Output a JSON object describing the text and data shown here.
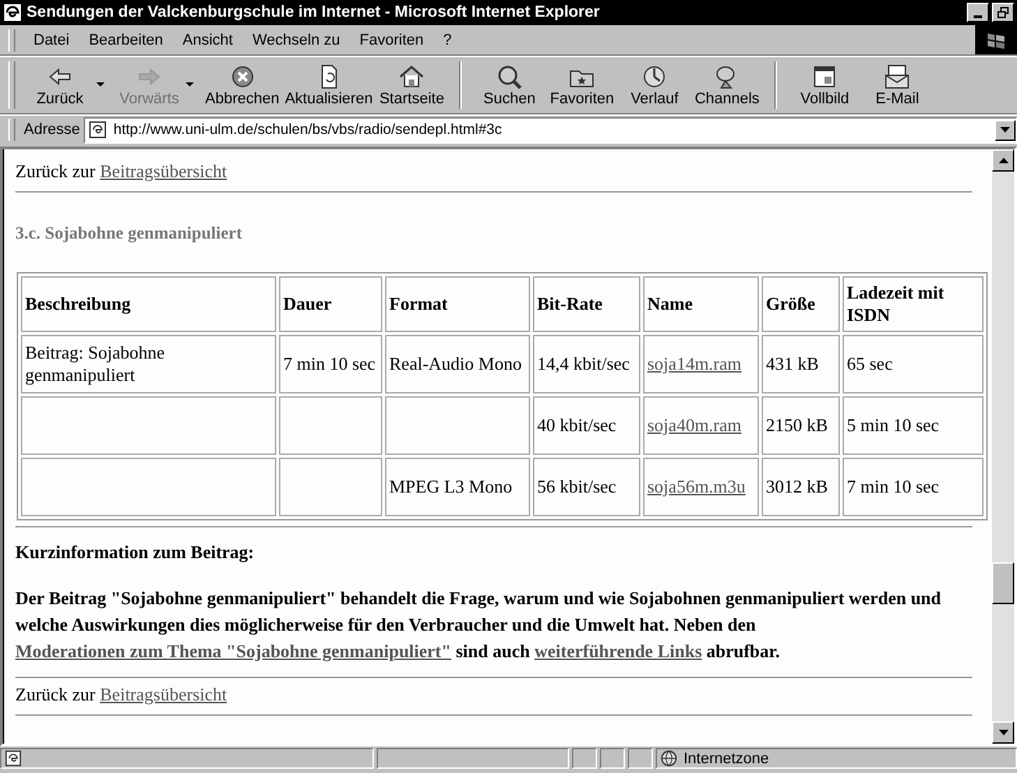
{
  "window": {
    "title": "Sendungen der Valckenburgschule im Internet - Microsoft Internet Explorer"
  },
  "menu": [
    "Datei",
    "Bearbeiten",
    "Ansicht",
    "Wechseln zu",
    "Favoriten",
    "?"
  ],
  "toolbar": [
    {
      "label": "Zurück",
      "disabled": false,
      "has_menu": true
    },
    {
      "label": "Vorwärts",
      "disabled": true,
      "has_menu": true
    },
    {
      "label": "Abbrechen",
      "disabled": false,
      "has_menu": false
    },
    {
      "label": "Aktualisieren",
      "disabled": false,
      "has_menu": false
    },
    {
      "label": "Startseite",
      "disabled": false,
      "has_menu": false
    },
    {
      "label": "Suchen",
      "disabled": false,
      "has_menu": false
    },
    {
      "label": "Favoriten",
      "disabled": false,
      "has_menu": false
    },
    {
      "label": "Verlauf",
      "disabled": false,
      "has_menu": false
    },
    {
      "label": "Channels",
      "disabled": false,
      "has_menu": false
    },
    {
      "label": "Vollbild",
      "disabled": false,
      "has_menu": false
    },
    {
      "label": "E-Mail",
      "disabled": false,
      "has_menu": false
    }
  ],
  "address": {
    "label": "Adresse",
    "value": "http://www.uni-ulm.de/schulen/bs/vbs/radio/sendepl.html#3c"
  },
  "page": {
    "back_top": {
      "text": "Zurück zur",
      "link": "Beitragsübersicht"
    },
    "heading": "3.c. Sojabohne genmanipuliert",
    "table": {
      "columns": [
        "Beschreibung",
        "Dauer",
        "Format",
        "Bit-Rate",
        "Name",
        "Größe",
        "Ladezeit mit ISDN"
      ],
      "rows": [
        [
          {
            "text": "Beitrag: Sojabohne genmanipuliert",
            "link": false
          },
          {
            "text": "7 min 10 sec",
            "link": false
          },
          {
            "text": "Real-Audio Mono",
            "link": false
          },
          {
            "text": "14,4 kbit/sec",
            "link": false
          },
          {
            "text": "soja14m.ram",
            "link": true
          },
          {
            "text": "431 kB",
            "link": false
          },
          {
            "text": "65 sec",
            "link": false
          }
        ],
        [
          null,
          null,
          null,
          {
            "text": "40 kbit/sec",
            "link": false
          },
          {
            "text": "soja40m.ram",
            "link": true
          },
          {
            "text": "2150 kB",
            "link": false
          },
          {
            "text": "5 min 10 sec",
            "link": false
          }
        ],
        [
          null,
          null,
          {
            "text": "MPEG L3 Mono",
            "link": false
          },
          {
            "text": "56 kbit/sec",
            "link": false
          },
          {
            "text": "soja56m.m3u",
            "link": true
          },
          {
            "text": "3012 kB",
            "link": false
          },
          {
            "text": "7 min 10 sec",
            "link": false
          }
        ]
      ]
    },
    "info_heading": "Kurzinformation zum Beitrag:",
    "info": [
      {
        "kind": "text",
        "text": "Der Beitrag \"Sojabohne genmanipuliert\" behandelt die Frage, warum und wie Sojabohnen genmanipuliert werden und welche Auswirkungen dies möglicherweise für den Verbraucher und die Umwelt hat. Neben den"
      },
      {
        "kind": "link",
        "text": "Moderationen zum Thema \"Sojabohne genmanipuliert\""
      },
      {
        "kind": "text",
        "text": "sind auch"
      },
      {
        "kind": "link",
        "text": "weiterführende Links"
      },
      {
        "kind": "text",
        "text": "abrufbar."
      }
    ],
    "back_bottom": {
      "text": "Zurück zur",
      "link": "Beitragsübersicht"
    }
  },
  "status_bar": {
    "zone": "Internetzone"
  }
}
